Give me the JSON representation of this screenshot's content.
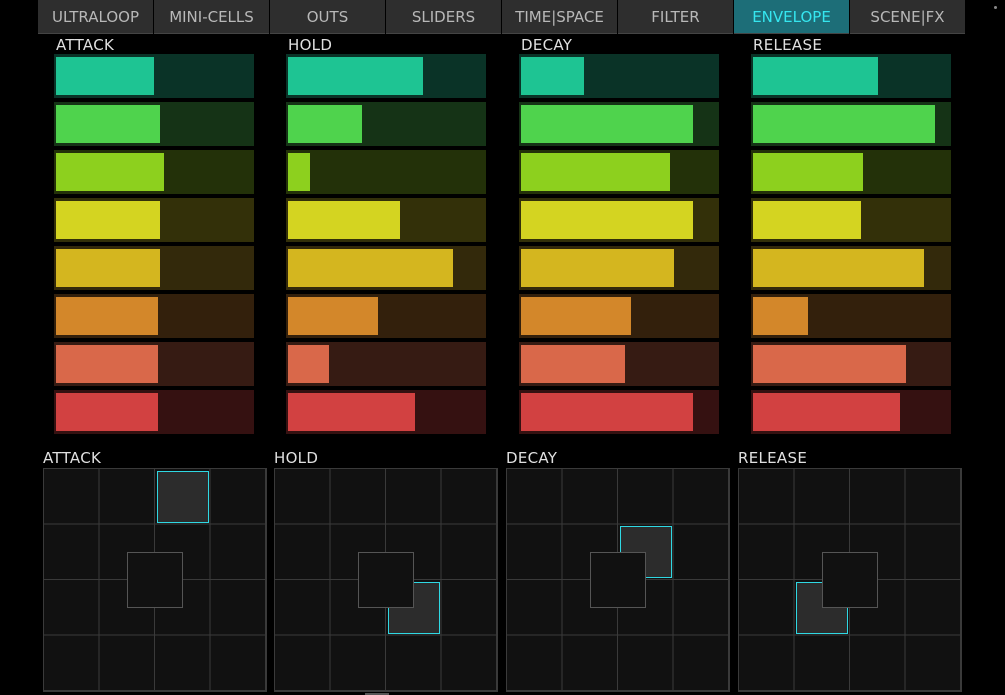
{
  "tabs": [
    "ULTRALOOP",
    "MINI-CELLS",
    "OUTS",
    "SLIDERS",
    "TIME|SPACE",
    "FILTER",
    "ENVELOPE",
    "SCENE|FX"
  ],
  "active_tab": 6,
  "row_colors": [
    {
      "fill": "#1ec493",
      "bg": "#0a3327"
    },
    {
      "fill": "#4fd34d",
      "bg": "#153316"
    },
    {
      "fill": "#8dd01e",
      "bg": "#233109"
    },
    {
      "fill": "#d4d421",
      "bg": "#333009"
    },
    {
      "fill": "#d4b61f",
      "bg": "#33290b"
    },
    {
      "fill": "#d3872a",
      "bg": "#33200c"
    },
    {
      "fill": "#d9684a",
      "bg": "#361b13"
    },
    {
      "fill": "#d24141",
      "bg": "#351111"
    }
  ],
  "columns": [
    {
      "title": "ATTACK",
      "values": [
        0.5,
        0.53,
        0.55,
        0.53,
        0.53,
        0.52,
        0.52,
        0.52
      ]
    },
    {
      "title": "HOLD",
      "values": [
        0.69,
        0.38,
        0.11,
        0.57,
        0.84,
        0.46,
        0.21,
        0.65
      ]
    },
    {
      "title": "DECAY",
      "values": [
        0.32,
        0.88,
        0.76,
        0.88,
        0.78,
        0.56,
        0.53,
        0.88
      ]
    },
    {
      "title": "RELEASE",
      "values": [
        0.64,
        0.93,
        0.56,
        0.55,
        0.87,
        0.28,
        0.78,
        0.75
      ]
    }
  ],
  "pads": [
    {
      "title": "ATTACK",
      "cursor_col": 2,
      "cursor_row": 0
    },
    {
      "title": "HOLD",
      "cursor_col": 2,
      "cursor_row": 2
    },
    {
      "title": "DECAY",
      "cursor_col": 2,
      "cursor_row": 1
    },
    {
      "title": "RELEASE",
      "cursor_col": 1,
      "cursor_row": 2
    }
  ]
}
